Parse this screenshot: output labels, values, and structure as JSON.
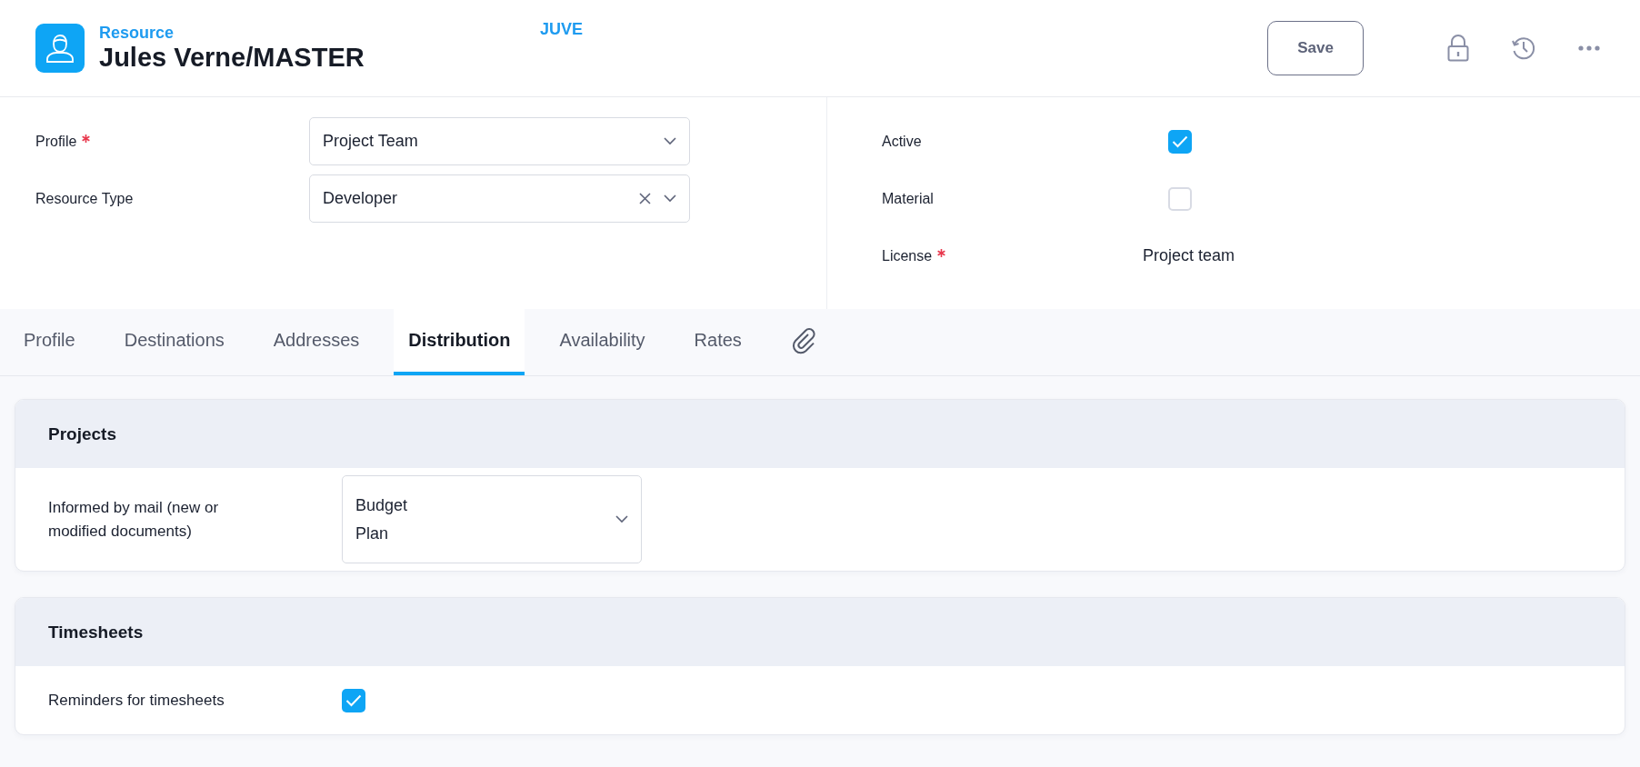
{
  "header": {
    "category": "Resource",
    "title": "Jules Verne/MASTER",
    "code": "JUVE",
    "save_label": "Save"
  },
  "form": {
    "left": [
      {
        "label": "Profile",
        "required": true,
        "value": "Project Team",
        "clearable": false
      },
      {
        "label": "Resource Type",
        "required": false,
        "value": "Developer",
        "clearable": true
      }
    ],
    "right": [
      {
        "kind": "checkbox",
        "label": "Active",
        "required": false,
        "checked": true
      },
      {
        "kind": "checkbox",
        "label": "Material",
        "required": false,
        "checked": false
      },
      {
        "kind": "text",
        "label": "License",
        "required": true,
        "value": "Project team"
      }
    ]
  },
  "tabs": [
    {
      "kind": "text",
      "label": "Profile",
      "selected": false
    },
    {
      "kind": "text",
      "label": "Destinations",
      "selected": false
    },
    {
      "kind": "text",
      "label": "Addresses",
      "selected": false
    },
    {
      "kind": "text",
      "label": "Distribution",
      "selected": true
    },
    {
      "kind": "text",
      "label": "Availability",
      "selected": false
    },
    {
      "kind": "text",
      "label": "Rates",
      "selected": false
    },
    {
      "kind": "attachment",
      "selected": false
    }
  ],
  "sections": [
    {
      "title": "Projects",
      "rows": [
        {
          "kind": "multiselect",
          "label": "Informed by mail (new or modified documents)",
          "values": [
            "Budget",
            "Plan"
          ]
        }
      ]
    },
    {
      "title": "Timesheets",
      "rows": [
        {
          "kind": "checkbox",
          "label": "Reminders for timesheets",
          "checked": true
        }
      ]
    }
  ]
}
